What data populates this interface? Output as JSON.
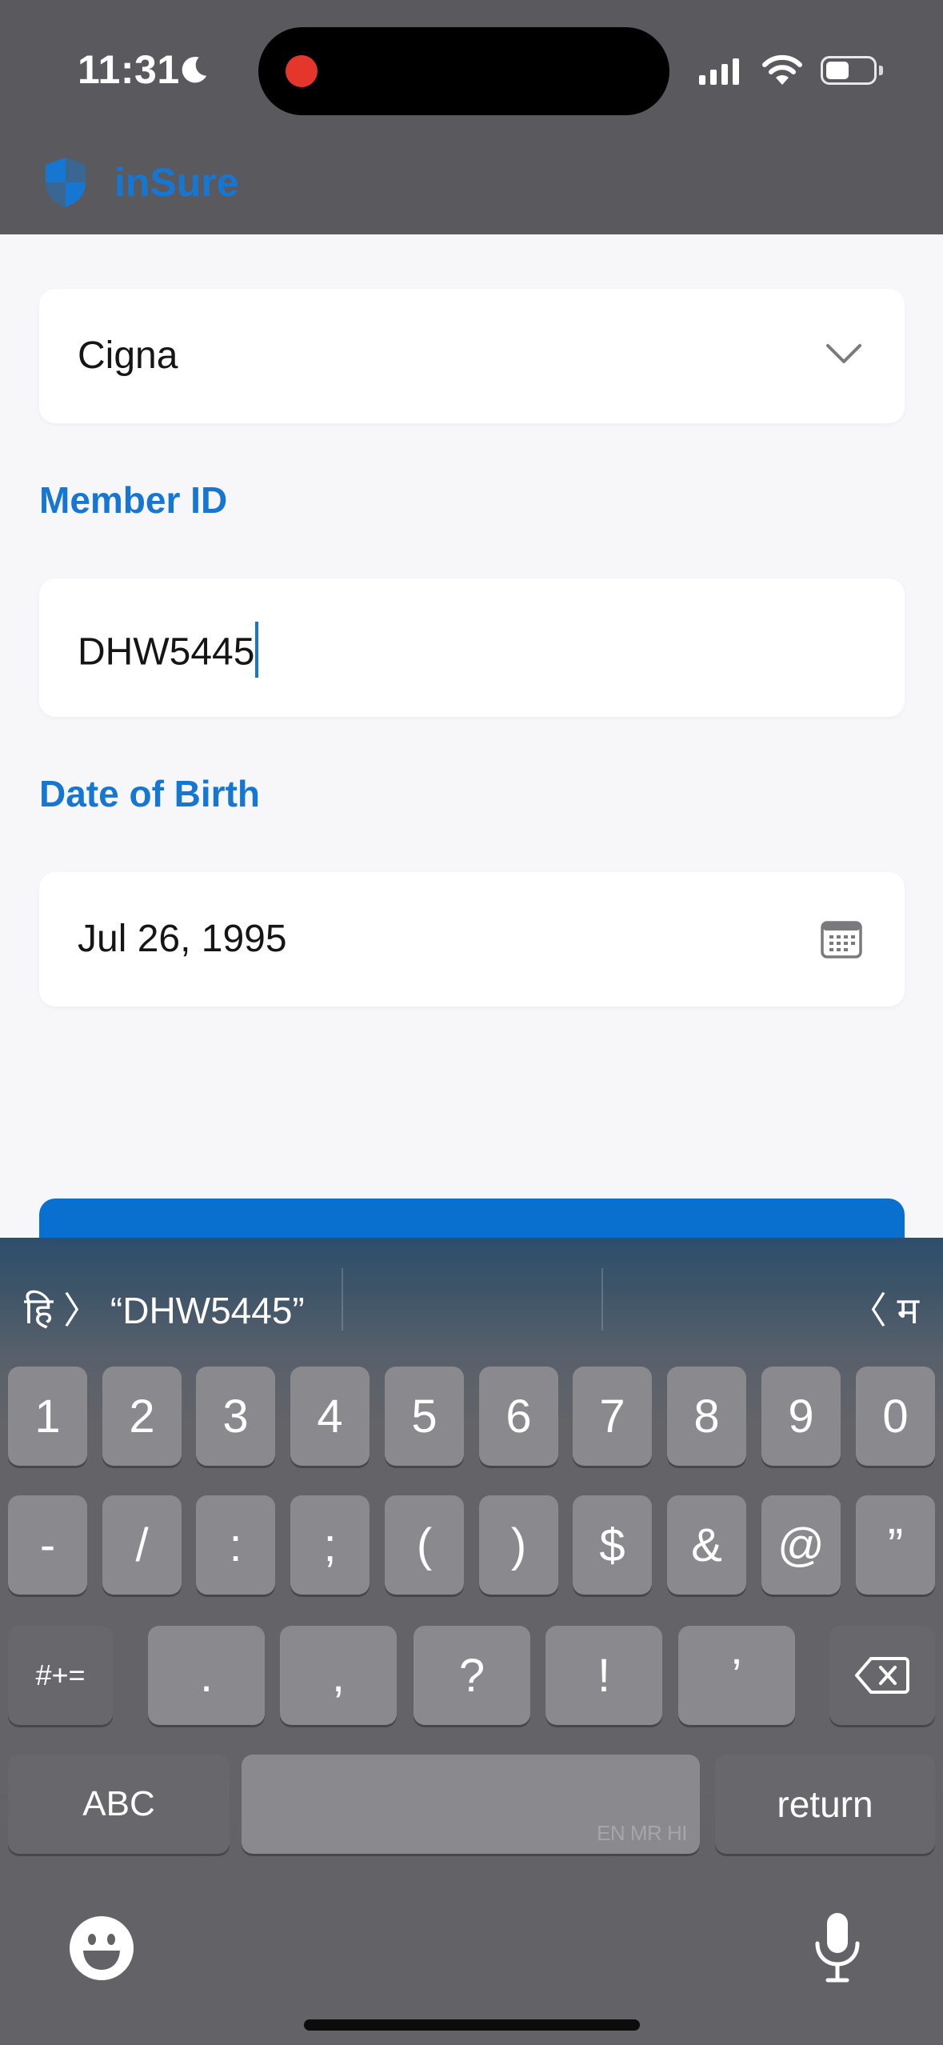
{
  "status_bar": {
    "time": "11:31",
    "moon_icon": "moon-icon",
    "recording_color": "#e5362b",
    "signal_icon": "cellular-signal-icon",
    "wifi_icon": "wifi-icon",
    "battery_icon": "battery-icon"
  },
  "header": {
    "app_name": "inSure",
    "logo_icon": "shield-icon",
    "brand_color": "#1677d2"
  },
  "form": {
    "provider": {
      "value": "Cigna",
      "icon": "chevron-down-icon"
    },
    "member_id": {
      "label": "Member ID",
      "value": "DHW5445"
    },
    "date_of_birth": {
      "label": "Date of Birth",
      "value": "Jul 26, 1995",
      "icon": "calendar-icon"
    },
    "submit_color": "#0a70cf"
  },
  "keyboard": {
    "suggestion_left": "हि 〉 “DHW5445”",
    "suggestion_right": "〈 म",
    "row1": [
      "1",
      "2",
      "3",
      "4",
      "5",
      "6",
      "7",
      "8",
      "9",
      "0"
    ],
    "row2": [
      "-",
      "/",
      ":",
      ";",
      "(",
      ")",
      "$",
      "&",
      "@",
      "”"
    ],
    "row3_switch": "#+=",
    "row3": [
      ".",
      ",",
      "?",
      "!",
      "’"
    ],
    "backspace_icon": "backspace-icon",
    "abc_label": "ABC",
    "space_lang_label": "EN MR HI",
    "return_label": "return",
    "emoji_icon": "emoji-icon",
    "mic_icon": "microphone-icon"
  }
}
